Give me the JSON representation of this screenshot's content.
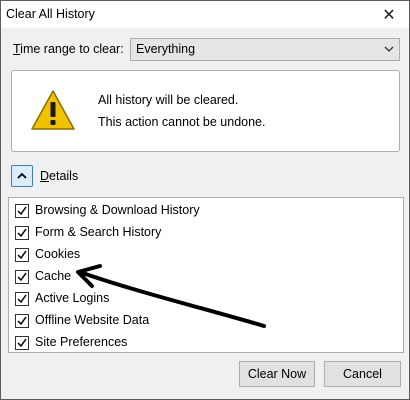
{
  "window": {
    "title": "Clear All History",
    "close_glyph": "✕"
  },
  "time_range": {
    "label_prefix": "",
    "label_access": "T",
    "label_rest": "ime range to clear:",
    "selected": "Everything"
  },
  "warning": {
    "icon": "warning-triangle-icon",
    "line1": "All history will be cleared.",
    "line2": "This action cannot be undone."
  },
  "details": {
    "label_access": "D",
    "label_rest": "etails",
    "expanded": true
  },
  "items": [
    {
      "label": "Browsing & Download History",
      "checked": true
    },
    {
      "label": "Form & Search History",
      "checked": true
    },
    {
      "label": "Cookies",
      "checked": true
    },
    {
      "label": "Cache",
      "checked": true
    },
    {
      "label": "Active Logins",
      "checked": true
    },
    {
      "label": "Offline Website Data",
      "checked": true
    },
    {
      "label": "Site Preferences",
      "checked": true
    }
  ],
  "buttons": {
    "clear_now": "Clear Now",
    "cancel": "Cancel"
  },
  "colors": {
    "warning_yellow": "#f2c200",
    "toggle_border": "#3c7fb1"
  }
}
